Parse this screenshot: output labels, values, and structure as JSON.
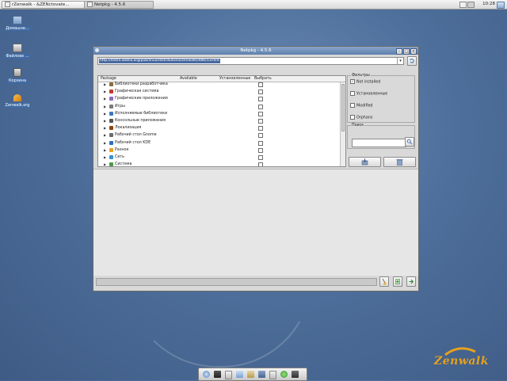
{
  "taskbar": {
    "tasks": [
      {
        "label": "rZenwalk - &ZENctovate..."
      },
      {
        "label": "Netpkg - 4.5.6"
      }
    ],
    "clock": "10:28"
  },
  "desktop": {
    "icons": [
      {
        "label": "Домашне...",
        "icon": "home-folder-icon"
      },
      {
        "label": "Файлове ...",
        "icon": "drive-icon"
      },
      {
        "label": "Корзина",
        "icon": "trash-icon"
      },
      {
        "label": "Zenwalk.org",
        "icon": "zenwalk-web-icon"
      }
    ]
  },
  "window": {
    "title": "Netpkg - 4.5.6",
    "url": "http://distro.ibiblio.org/pub/linux/distributions/zenwalk/i486/current"
  },
  "package_list": {
    "columns": [
      "Package",
      "Available",
      "Установленные",
      "Выбрать"
    ],
    "rows": [
      {
        "name": "Библиотеки разработчика",
        "icon_color": "#8a6d3b"
      },
      {
        "name": "Графическая система",
        "icon_color": "#c0392b"
      },
      {
        "name": "Графические приложения",
        "icon_color": "#8e6bbf"
      },
      {
        "name": "Игры",
        "icon_color": "#7a7a7a"
      },
      {
        "name": "Исполняемые библиотеки",
        "icon_color": "#3a78c2"
      },
      {
        "name": "Консольные приложения",
        "icon_color": "#555555"
      },
      {
        "name": "Локализация",
        "icon_color": "#8b4513"
      },
      {
        "name": "Рабочий стол Gnome",
        "icon_color": "#6d6d6d"
      },
      {
        "name": "Рабочий стол KDE",
        "icon_color": "#2f6fbf"
      },
      {
        "name": "Разное",
        "icon_color": "#e6a11d"
      },
      {
        "name": "Сеть",
        "icon_color": "#3b8fd0"
      },
      {
        "name": "Система",
        "icon_color": "#4a9a4a"
      }
    ]
  },
  "filters": {
    "title": "Фильтры",
    "items": [
      {
        "label": "Not installed",
        "checked": true,
        "mark": "✓"
      },
      {
        "label": "Установленные",
        "checked": false,
        "mark": ""
      },
      {
        "label": "Modified",
        "checked": false,
        "mark": ""
      },
      {
        "label": "Orphans",
        "checked": false,
        "mark": ""
      }
    ]
  },
  "search": {
    "title": "Поиск",
    "value": ""
  },
  "brand": {
    "logo_text": "Zenwalk",
    "accent": "#e6a11d"
  },
  "colors": {
    "titlebar": "#6e8db8",
    "selection": "#4a6aa0",
    "desktop": "#4e6f9b"
  }
}
